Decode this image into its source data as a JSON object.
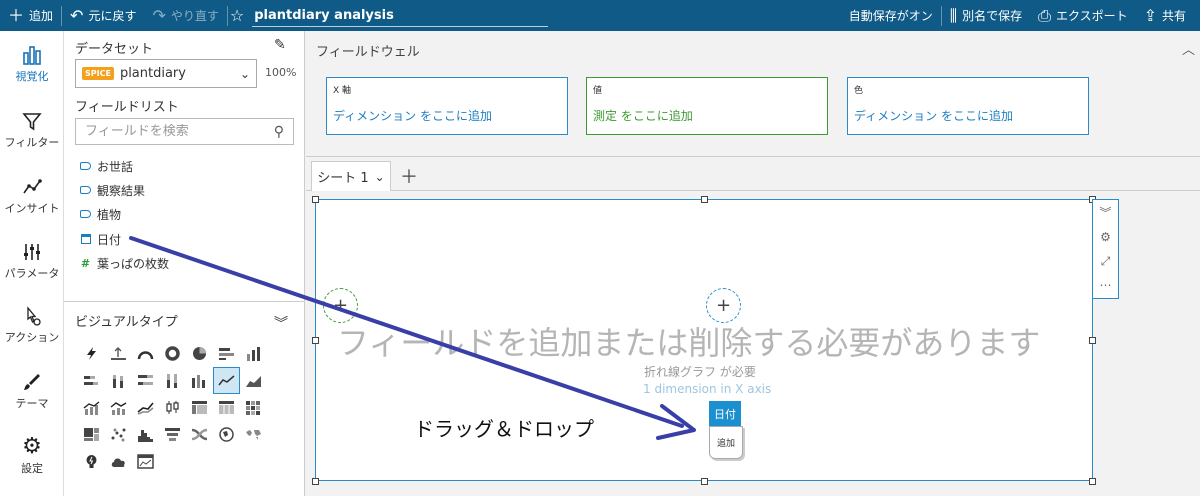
{
  "topbar": {
    "add": "追加",
    "undo": "元に戻す",
    "redo": "やり直す",
    "title_value": "plantdiary analysis",
    "autosave": "自動保存がオン",
    "save_as": "別名で保存",
    "export": "エクスポート",
    "share": "共有"
  },
  "rail": {
    "items": [
      {
        "label": "視覚化",
        "icon": "bar-chart-icon"
      },
      {
        "label": "フィルター",
        "icon": "filter-icon"
      },
      {
        "label": "インサイト",
        "icon": "insight-icon"
      },
      {
        "label": "パラメータ",
        "icon": "sliders-icon"
      },
      {
        "label": "アクション",
        "icon": "pointer-gear-icon"
      },
      {
        "label": "テーマ",
        "icon": "brush-icon"
      },
      {
        "label": "設定",
        "icon": "gear-icon"
      }
    ]
  },
  "panel": {
    "dataset_label": "データセット",
    "spice_badge": "SPICE",
    "dataset_name": "plantdiary",
    "dataset_percent": "100%",
    "field_list_label": "フィールドリスト",
    "search_placeholder": "フィールドを検索",
    "fields": [
      {
        "name": "お世話",
        "type": "dimension"
      },
      {
        "name": "観察結果",
        "type": "dimension"
      },
      {
        "name": "植物",
        "type": "dimension"
      },
      {
        "name": "日付",
        "type": "date"
      },
      {
        "name": "葉っぱの枚数",
        "type": "measure"
      }
    ],
    "visual_types_label": "ビジュアルタイプ"
  },
  "wells": {
    "title": "フィールドウェル",
    "items": [
      {
        "label": "X 軸",
        "value": "ディメンション をここに追加"
      },
      {
        "label": "値",
        "value": "測定 をここに追加"
      },
      {
        "label": "色",
        "value": "ディメンション をここに追加"
      }
    ]
  },
  "sheet": {
    "tab_label": "シート 1"
  },
  "visual": {
    "message": "フィールドを追加または削除する必要があります",
    "requirement": "折れ線グラフ が必要",
    "requirement_detail": "1 dimension in X axis",
    "drag_chip_field": "日付",
    "drag_chip_action": "追加"
  },
  "annotation": {
    "label": "ドラッグ＆ドロップ",
    "color": "#3a3fa8"
  },
  "colors": {
    "topbar": "#0f5a87",
    "accent_blue": "#2a8bc8",
    "accent_green": "#3c9b30",
    "spice": "#f5a01a"
  }
}
